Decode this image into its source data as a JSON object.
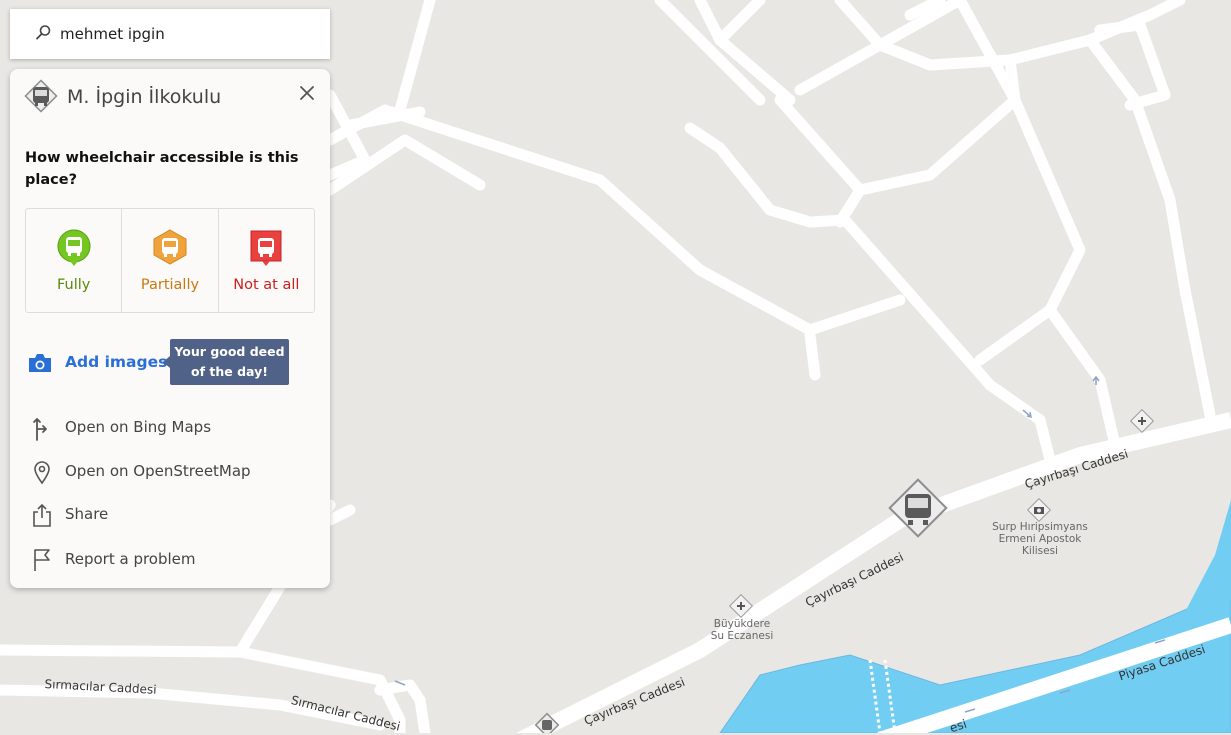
{
  "search": {
    "value": "mehmet ipgin"
  },
  "panel": {
    "title": "M. İpgin İlkokulu",
    "question": "How wheelchair accessible is this place?",
    "options": [
      {
        "label": "Fully",
        "color": "#5a8a0f",
        "icon_color": "#74c620"
      },
      {
        "label": "Partially",
        "color": "#c77a12",
        "icon_color": "#f0a33b"
      },
      {
        "label": "Not at all",
        "color": "#c9211f",
        "icon_color": "#e8413f"
      }
    ],
    "add_images": "Add images",
    "tooltip": "Your good deed of the day!",
    "links": [
      {
        "label": "Open on Bing Maps",
        "icon": "bing-directions-icon"
      },
      {
        "label": "Open on OpenStreetMap",
        "icon": "map-pin-icon"
      },
      {
        "label": "Share",
        "icon": "share-icon"
      },
      {
        "label": "Report a problem",
        "icon": "flag-icon"
      }
    ]
  },
  "map": {
    "streets": {
      "cayirbasi_1": "Çayırbaşı Caddesi",
      "cayirbasi_2": "Çayırbaşı Caddesi",
      "cayirbasi_3": "Çayırbaşı Caddesi",
      "piyasa": "Piyasa Caddesi",
      "sirmacilar_1": "Sırmacılar Caddesi",
      "sirmacilar_2": "Sırmacılar Caddesi",
      "partial": "esi"
    },
    "pois": {
      "church": "Surp Hıripsimyans Ermeni Apostok Kilisesi",
      "pharmacy": "Büyükdere Su Eczanesi"
    },
    "colors": {
      "land": "#e9e7e3",
      "road": "#ffffff",
      "water": "#72cdf2"
    }
  }
}
